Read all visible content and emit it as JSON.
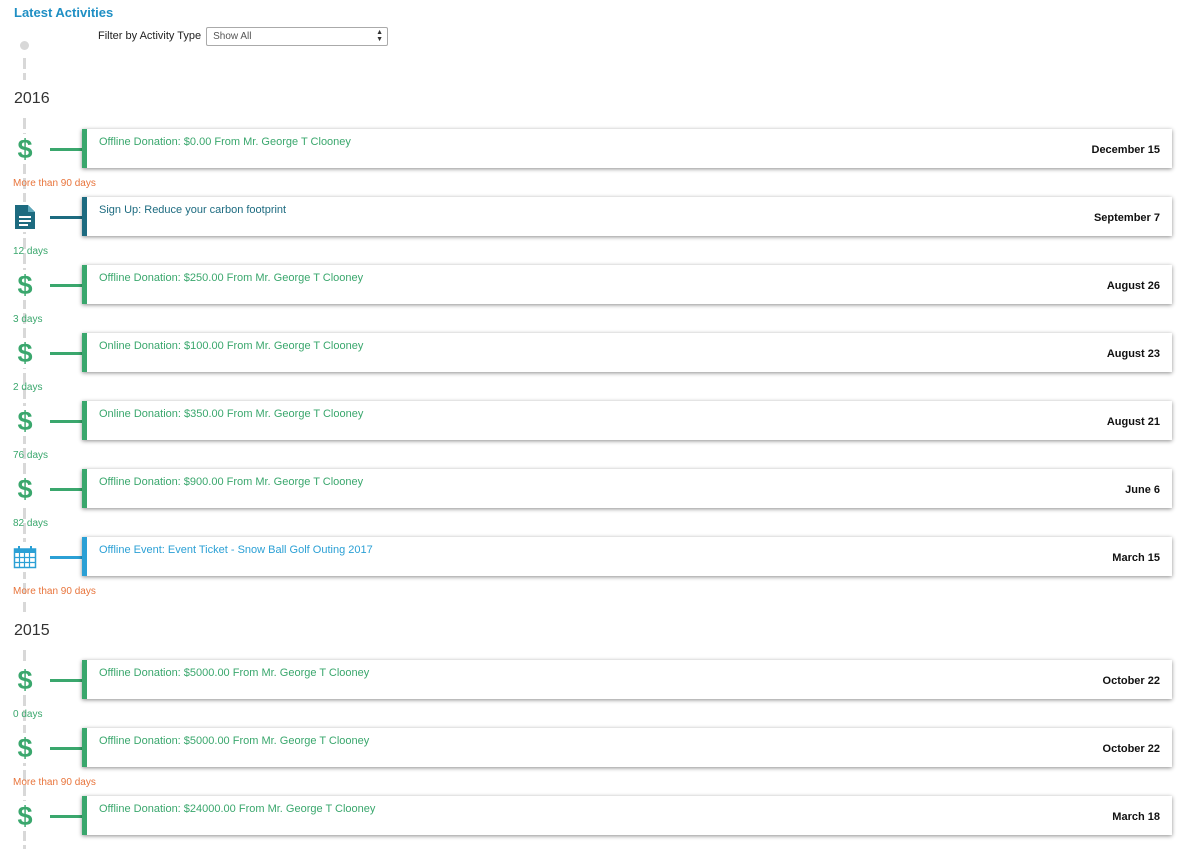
{
  "header": {
    "title": "Latest Activities",
    "filter_label": "Filter by Activity Type",
    "filter_value": "Show All"
  },
  "colors": {
    "donation": "#3aa76d",
    "signup": "#1d6b80",
    "event": "#2ba0d5",
    "gap_recent": "#3aa76d",
    "gap_old": "#e8743b"
  },
  "groups": [
    {
      "year": "2016",
      "items": [
        {
          "icon": "dollar-icon",
          "type": "donation",
          "title": "Offline Donation: $0.00 From Mr. George T Clooney",
          "date": "December 15",
          "gap_after": "More than 90 days",
          "gap_kind": "old"
        },
        {
          "icon": "document-icon",
          "type": "signup",
          "title": "Sign Up: Reduce your carbon footprint",
          "date": "September 7",
          "gap_after": "12 days",
          "gap_kind": "recent"
        },
        {
          "icon": "dollar-icon",
          "type": "donation",
          "title": "Offline Donation: $250.00 From Mr. George T Clooney",
          "date": "August 26",
          "gap_after": "3 days",
          "gap_kind": "recent"
        },
        {
          "icon": "dollar-icon",
          "type": "donation",
          "title": "Online Donation: $100.00 From Mr. George T Clooney",
          "date": "August 23",
          "gap_after": "2 days",
          "gap_kind": "recent"
        },
        {
          "icon": "dollar-icon",
          "type": "donation",
          "title": "Online Donation: $350.00 From Mr. George T Clooney",
          "date": "August 21",
          "gap_after": "76 days",
          "gap_kind": "recent"
        },
        {
          "icon": "dollar-icon",
          "type": "donation",
          "title": "Offline Donation: $900.00 From Mr. George T Clooney",
          "date": "June 6",
          "gap_after": "82 days",
          "gap_kind": "recent"
        },
        {
          "icon": "calendar-icon",
          "type": "event",
          "title": "Offline Event: Event Ticket - Snow Ball Golf Outing 2017",
          "date": "March 15",
          "gap_after": "More than 90 days",
          "gap_kind": "old"
        }
      ]
    },
    {
      "year": "2015",
      "items": [
        {
          "icon": "dollar-icon",
          "type": "donation",
          "title": "Offline Donation: $5000.00 From Mr. George T Clooney",
          "date": "October 22",
          "gap_after": "0 days",
          "gap_kind": "recent"
        },
        {
          "icon": "dollar-icon",
          "type": "donation",
          "title": "Offline Donation: $5000.00 From Mr. George T Clooney",
          "date": "October 22",
          "gap_after": "More than 90 days",
          "gap_kind": "old"
        },
        {
          "icon": "dollar-icon",
          "type": "donation",
          "title": "Offline Donation: $24000.00 From Mr. George T Clooney",
          "date": "March 18",
          "gap_after": "",
          "gap_kind": ""
        }
      ]
    }
  ]
}
